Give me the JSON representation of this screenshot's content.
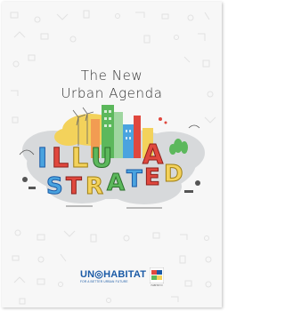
{
  "cover": {
    "title_line1": "The New",
    "title_line2": "Urban Agenda"
  },
  "artwork": {
    "letters_top": [
      "I",
      "L",
      "L",
      "U"
    ],
    "letters_bottom": [
      "S",
      "T",
      "R",
      "A",
      "T",
      "E",
      "D"
    ],
    "letters_mid": [
      "A"
    ]
  },
  "footer": {
    "logo_text": "UN◎HABITAT",
    "logo_tagline": "FOR A BETTER URBAN FUTURE",
    "badge_caption": "HABITAT III"
  },
  "colors": {
    "accent_blue": "#1a5aa6",
    "cloud_gray": "#d7d9db",
    "yellow": "#f3d25b",
    "green": "#5cb85c",
    "red": "#e0483e"
  }
}
